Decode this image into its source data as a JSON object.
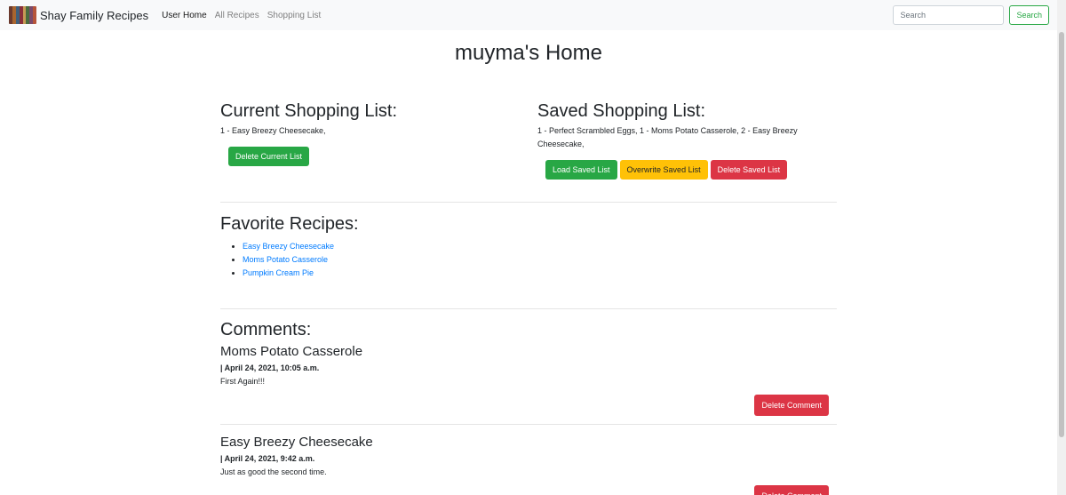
{
  "navbar": {
    "brand": "Shay Family Recipes",
    "links": [
      {
        "label": "User Home",
        "active": true
      },
      {
        "label": "All Recipes",
        "active": false
      },
      {
        "label": "Shopping List",
        "active": false
      }
    ],
    "search_placeholder": "Search",
    "search_button": "Search"
  },
  "page": {
    "title": "muyma's Home"
  },
  "current_list": {
    "heading": "Current Shopping List:",
    "items": "1 - Easy Breezy Cheesecake,",
    "delete_button": "Delete Current List"
  },
  "saved_list": {
    "heading": "Saved Shopping List:",
    "items": "1 - Perfect Scrambled Eggs, 1 - Moms Potato Casserole, 2 - Easy Breezy Cheesecake,",
    "load_button": "Load Saved List",
    "overwrite_button": "Overwrite Saved List",
    "delete_button": "Delete Saved List"
  },
  "favorites": {
    "heading": "Favorite Recipes:",
    "items": [
      "Easy Breezy Cheesecake",
      "Moms Potato Casserole",
      "Pumpkin Cream Pie"
    ]
  },
  "comments": {
    "heading": "Comments:",
    "items": [
      {
        "recipe": "Moms Potato Casserole",
        "date": "| April 24, 2021, 10:05 a.m.",
        "text": "First Again!!!",
        "delete_button": "Delete Comment"
      },
      {
        "recipe": "Easy Breezy Cheesecake",
        "date": "| April 24, 2021, 9:42 a.m.",
        "text": "Just as good the second time.",
        "delete_button": "Delete Comment"
      }
    ]
  },
  "colors": {
    "success": "#28a745",
    "warning": "#ffc107",
    "danger": "#dc3545",
    "link": "#007bff",
    "navbar_bg": "#f8f9fa"
  }
}
